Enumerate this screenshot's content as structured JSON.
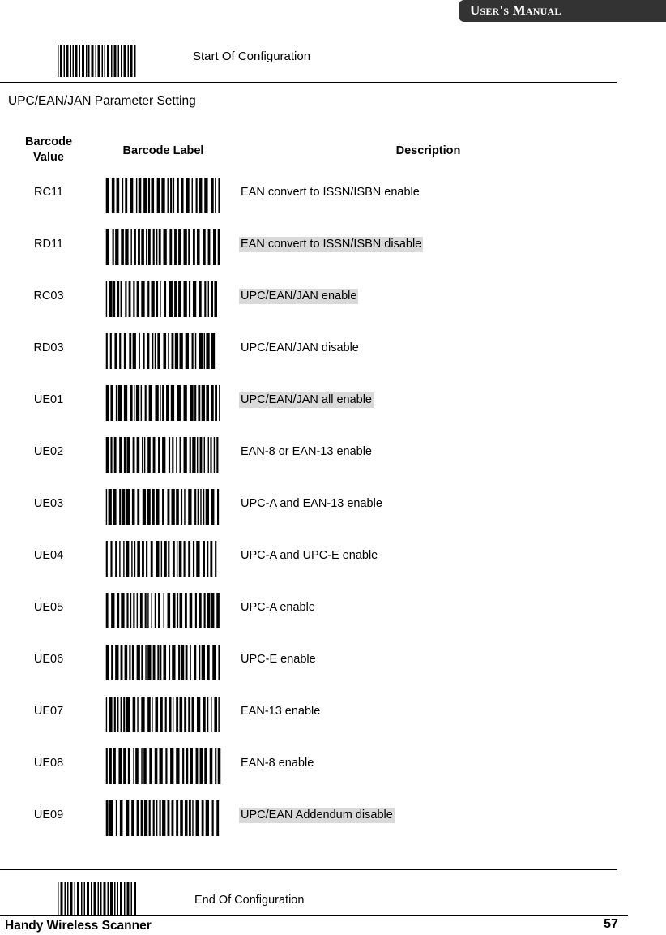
{
  "header": {
    "title": "User's Manual",
    "bar_color": "#333333",
    "text_color": "#ffffff"
  },
  "start_config": {
    "caption": "Start Of Configuration",
    "barcode_name": "start-of-configuration-barcode"
  },
  "section": {
    "title": "UPC/EAN/JAN Parameter Setting"
  },
  "table": {
    "headers": {
      "value_line1": "Barcode",
      "value_line2": "Value",
      "label": "Barcode Label",
      "description": "Description"
    },
    "highlight_color": "#d9d9d9",
    "rows": [
      {
        "value": "RC11",
        "description": "EAN convert to ISSN/ISBN enable",
        "highlighted": false
      },
      {
        "value": "RD11",
        "description": "EAN convert to ISSN/ISBN disable",
        "highlighted": true
      },
      {
        "value": "RC03",
        "description": "UPC/EAN/JAN enable",
        "highlighted": true
      },
      {
        "value": "RD03",
        "description": "UPC/EAN/JAN disable",
        "highlighted": false
      },
      {
        "value": "UE01",
        "description": "UPC/EAN/JAN all enable",
        "highlighted": true
      },
      {
        "value": "UE02",
        "description": "EAN-8 or EAN-13 enable",
        "highlighted": false
      },
      {
        "value": "UE03",
        "description": "UPC-A and EAN-13 enable",
        "highlighted": false
      },
      {
        "value": "UE04",
        "description": "UPC-A and UPC-E enable",
        "highlighted": false
      },
      {
        "value": "UE05",
        "description": "UPC-A enable",
        "highlighted": false
      },
      {
        "value": "UE06",
        "description": "UPC-E enable",
        "highlighted": false
      },
      {
        "value": "UE07",
        "description": "EAN-13 enable",
        "highlighted": false
      },
      {
        "value": "UE08",
        "description": "EAN-8 enable",
        "highlighted": false
      },
      {
        "value": "UE09",
        "description": "UPC/EAN Addendum disable",
        "highlighted": true
      }
    ]
  },
  "end_config": {
    "caption": "End Of Configuration",
    "barcode_name": "end-of-configuration-barcode"
  },
  "footer": {
    "product": "Handy Wireless Scanner",
    "page": "57"
  }
}
